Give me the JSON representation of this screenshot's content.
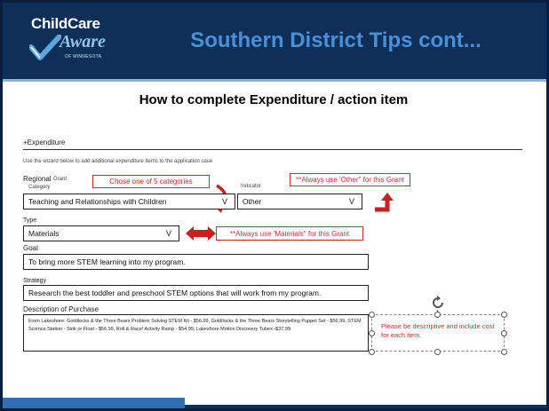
{
  "header": {
    "logo_line1": "ChildCare",
    "logo_line2": "Aware",
    "logo_state": "OF MINNESOTA",
    "title": "Southern District Tips cont..."
  },
  "panel": {
    "heading": "How to complete Expenditure / action item",
    "section_title": "+Expenditure",
    "helper_text": "Use the wizard below to add additional expenditure items to the application case",
    "regional_label": "Regional",
    "grant_label": "Grant",
    "category_label": "Category",
    "indicator_label": "Indicator",
    "category_value": "Teaching and Relationships with Children",
    "indicator_value": "Other",
    "type_label": "Type",
    "type_value": "Materials",
    "goal_label": "Goal",
    "goal_value": "To bring more STEM learning into my program.",
    "strategy_label": "Strategy",
    "strategy_value": "Research the best toddler and preschool STEM options that will work from my program.",
    "description_label": "Description of Purchase",
    "description_value": "From Lakeshore: Goldilocks & the Three Bears Problem Solving STEM Kit - $56.99, Goldilocks & the Three Bears Storytelling Puppet Set - $56.99, STEM Science Station - Sink or Float - $56.99, Roll & Race! Activity Ramp - $54.99, Lakeshore Motion Discovery Tubes -$37.99",
    "chevron": "V"
  },
  "notes": {
    "categories": "Chose one of 5 categories",
    "other": "**Always use 'Other\" for this Grant",
    "materials": "**Always use 'Materials\" for this Grant",
    "descriptive": "Please be descriptive and include cost for each item."
  },
  "colors": {
    "header_bg": "#0e2f58",
    "title": "#4a90d9",
    "note_red": "#d32a2a",
    "arrow_red": "#c81f1f"
  }
}
